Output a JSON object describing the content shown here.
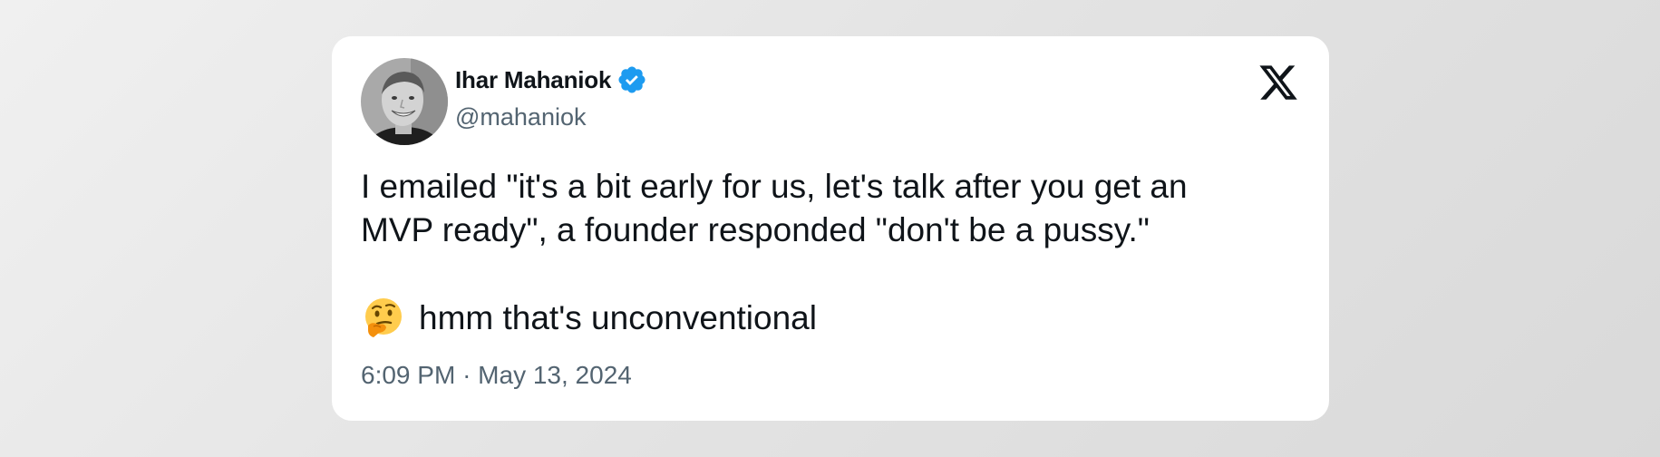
{
  "tweet": {
    "author_name": "Ihar Mahaniok",
    "author_handle": "@mahaniok",
    "verified": true,
    "verified_color": "#1d9bf0",
    "text_line_1": "I emailed \"it's a bit early for us, let's talk after you get an",
    "text_line_2": "MVP ready\", a founder responded \"don't be a pussy.\"",
    "emoji_icon": "thinking-face-icon",
    "text_line_3": "hmm that's unconventional",
    "time": "6:09 PM",
    "separator": "·",
    "date": "May 13, 2024"
  },
  "platform": {
    "logo_icon": "x-logo-icon"
  }
}
